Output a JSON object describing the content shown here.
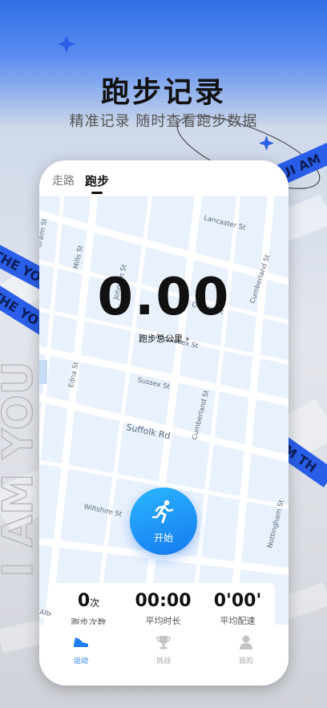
{
  "promo": {
    "headline": "跑步记录",
    "subline": "精准记录 随时查看跑步数据",
    "banner_text": "I AM YOU",
    "ribbon_left": "THE YOU",
    "ribbon_left2": "THE YO",
    "ribbon_right_top": "BUI AM",
    "ribbon_right_mid": "AM TH"
  },
  "tabs": [
    {
      "label": "走路",
      "active": false
    },
    {
      "label": "跑步",
      "active": true
    }
  ],
  "map": {
    "streets": [
      "Lancaster St",
      "Oxford St",
      "Cumberland St",
      "Middlesex St",
      "Sussex St",
      "Suffolk Rd",
      "Cumberland St",
      "Wiltshire St",
      "Nottingham St",
      "Albert St",
      "Mills St",
      "Johnson St",
      "Edna St",
      "Braim St"
    ]
  },
  "run": {
    "distance": "0.00",
    "distance_label": "跑步总公里",
    "start_label": "开始"
  },
  "stats": [
    {
      "value": "0",
      "unit": "次",
      "label": "跑步次数"
    },
    {
      "value": "00:00",
      "unit": "",
      "label": "平均时长"
    },
    {
      "value": "0'00'",
      "unit": "",
      "label": "平均配速"
    }
  ],
  "nav": [
    {
      "label": "运动",
      "icon": "shoe-icon",
      "active": true
    },
    {
      "label": "挑战",
      "icon": "trophy-icon",
      "active": false
    },
    {
      "label": "我的",
      "icon": "user-icon",
      "active": false
    }
  ],
  "colors": {
    "accent": "#1f7ef2",
    "map_bg": "#e9f1fd",
    "ribbon": "#2a5ee8"
  }
}
